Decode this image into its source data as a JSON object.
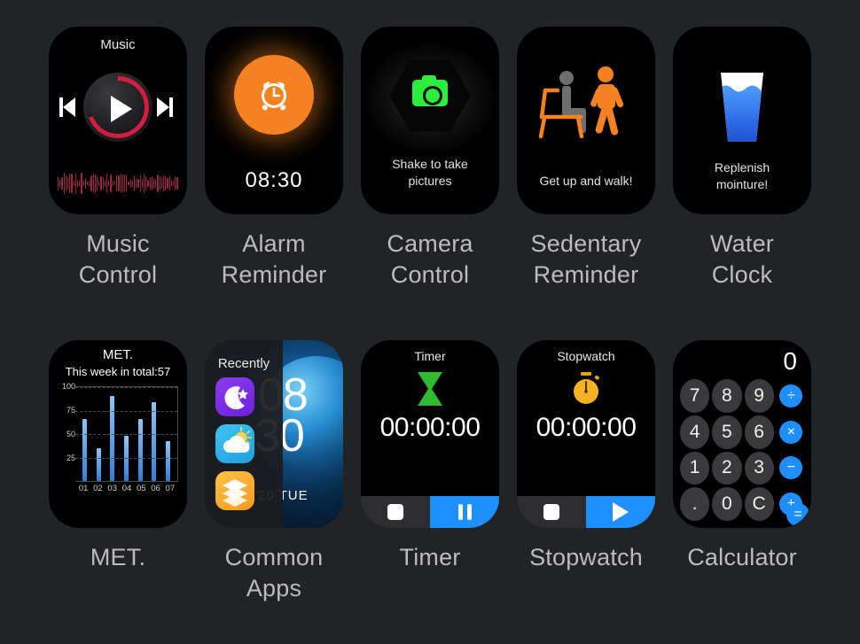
{
  "theme": {
    "background": "#222327",
    "card_bg": "#000000",
    "caption_color": "#bcbcbc",
    "accent_blue": "#1f8fff",
    "accent_orange": "#f58220",
    "accent_green": "#2bed3b",
    "accent_red": "#d21d45"
  },
  "cards": [
    {
      "id": "music-control",
      "caption_line1": "Music",
      "caption_line2": "Control",
      "screen": {
        "title": "Music",
        "prev_icon": "previous-track-icon",
        "play_icon": "play-icon",
        "next_icon": "next-track-icon",
        "waveform_icon": "audio-waveform"
      }
    },
    {
      "id": "alarm-reminder",
      "caption_line1": "Alarm",
      "caption_line2": "Reminder",
      "screen": {
        "alarm_icon": "alarm-clock-icon",
        "time": "08:30"
      }
    },
    {
      "id": "camera-control",
      "caption_line1": "Camera",
      "caption_line2": "Control",
      "screen": {
        "camera_icon": "camera-icon",
        "text_line1": "Shake to take",
        "text_line2": "pictures"
      }
    },
    {
      "id": "sedentary-reminder",
      "caption_line1": "Sedentary",
      "caption_line2": "Reminder",
      "screen": {
        "sitting_icon": "person-sitting-icon",
        "walking_icon": "person-walking-icon",
        "text": "Get up and walk!"
      }
    },
    {
      "id": "water-clock",
      "caption_line1": "Water",
      "caption_line2": "Clock",
      "screen": {
        "glass_icon": "water-glass-icon",
        "text_line1": "Replenish",
        "text_line2": "mointure!"
      }
    },
    {
      "id": "met",
      "caption_line1": "MET.",
      "caption_line2": "",
      "screen": {
        "title": "MET.",
        "subtitle": "This week in total:57"
      }
    },
    {
      "id": "common-apps",
      "caption_line1": "Common",
      "caption_line2": "Apps",
      "screen": {
        "panel_title": "Recently",
        "watch_hour": "08",
        "watch_minute": "30",
        "watch_date": "20 TUE",
        "app_icons": [
          {
            "name": "sleep-moon-icon",
            "color": "#8b3cf0"
          },
          {
            "name": "weather-cloud-sun-icon",
            "color": "#3ec6f5"
          },
          {
            "name": "layers-stack-icon",
            "color": "#ffc247"
          }
        ]
      }
    },
    {
      "id": "timer",
      "caption_line1": "Timer",
      "caption_line2": "",
      "screen": {
        "title": "Timer",
        "hourglass_icon": "hourglass-icon",
        "time": "00:00:00",
        "stop_icon": "stop-square-icon",
        "action_icon": "pause-icon"
      }
    },
    {
      "id": "stopwatch",
      "caption_line1": "Stopwatch",
      "caption_line2": "",
      "screen": {
        "title": "Stopwatch",
        "stopwatch_icon": "stopwatch-icon",
        "time": "00:00:00",
        "stop_icon": "stop-square-icon",
        "action_icon": "play-icon"
      }
    },
    {
      "id": "calculator",
      "caption_line1": "Calculator",
      "caption_line2": "",
      "screen": {
        "display": "0",
        "keys": [
          "7",
          "8",
          "9",
          "÷",
          "4",
          "5",
          "6",
          "×",
          "1",
          "2",
          "3",
          "−",
          ".",
          "0",
          "C",
          "+"
        ],
        "equals": "="
      }
    }
  ],
  "chart_data": {
    "type": "bar",
    "title": "MET.",
    "subtitle": "This week in total:57",
    "categories": [
      "01",
      "02",
      "03",
      "04",
      "05",
      "06",
      "07"
    ],
    "values": [
      66,
      35,
      91,
      48,
      66,
      84,
      42
    ],
    "xlabel": "",
    "ylabel": "",
    "ylim": [
      0,
      100
    ],
    "yticks": [
      25,
      50,
      75,
      100
    ],
    "grid": true,
    "legend": "none",
    "bar_color": "#2f7fd6"
  }
}
